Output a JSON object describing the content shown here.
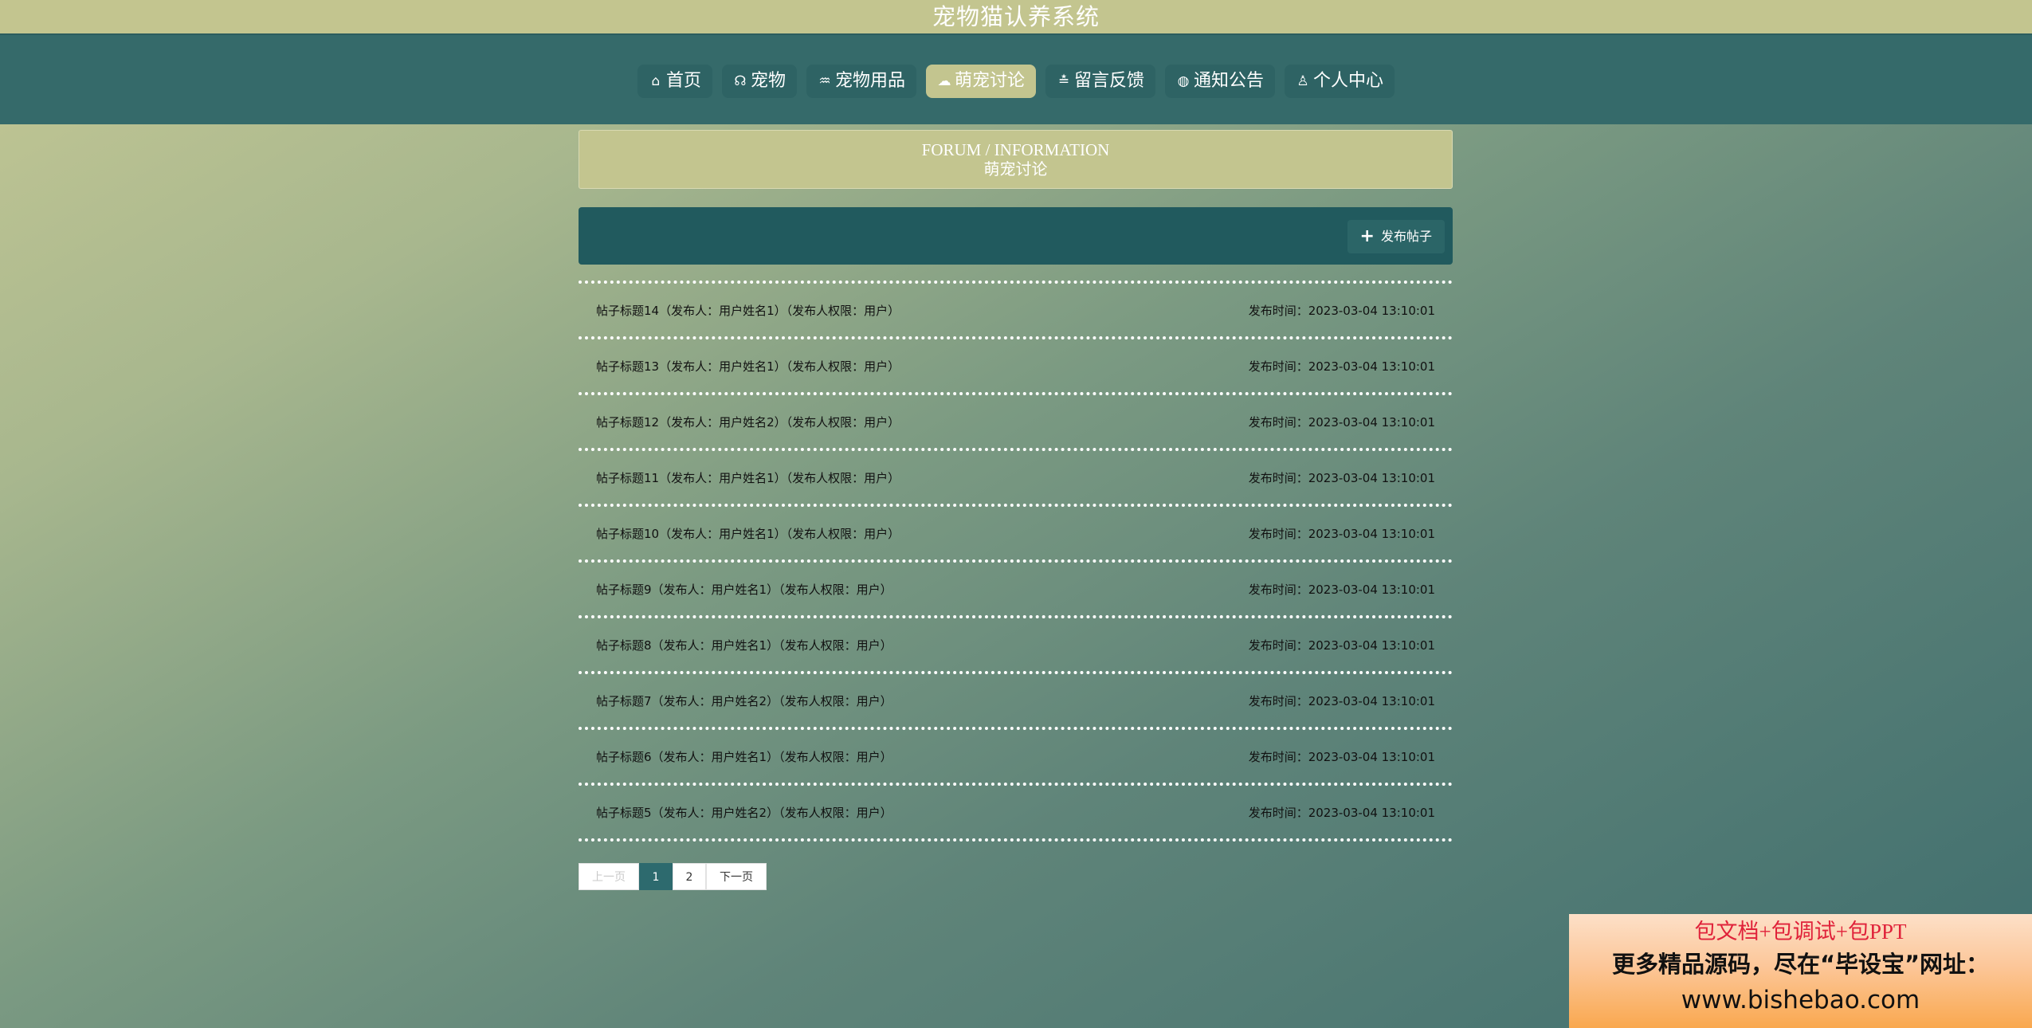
{
  "app": {
    "title": "宠物猫认养系统"
  },
  "nav": [
    {
      "icon": "home-icon",
      "glyph": "⌂",
      "label": "首页",
      "active": false
    },
    {
      "icon": "pet-icon",
      "glyph": "☊",
      "label": "宠物",
      "active": false
    },
    {
      "icon": "supplies-icon",
      "glyph": "♒",
      "label": "宠物用品",
      "active": false
    },
    {
      "icon": "cloud-icon",
      "glyph": "☁",
      "label": "萌宠讨论",
      "active": true
    },
    {
      "icon": "sliders-icon",
      "glyph": "≛",
      "label": "留言反馈",
      "active": false
    },
    {
      "icon": "globe-icon",
      "glyph": "◍",
      "label": "通知公告",
      "active": false
    },
    {
      "icon": "user-icon",
      "glyph": "♙",
      "label": "个人中心",
      "active": false
    }
  ],
  "banner": {
    "en": "FORUM / INFORMATION",
    "cn": "萌宠讨论"
  },
  "toolbar": {
    "add_label": "发布帖子"
  },
  "posts": [
    {
      "title": "帖子标题14（发布人：用户姓名1）（发布人权限：用户）",
      "time": "发布时间：2023-03-04 13:10:01"
    },
    {
      "title": "帖子标题13（发布人：用户姓名1）（发布人权限：用户）",
      "time": "发布时间：2023-03-04 13:10:01"
    },
    {
      "title": "帖子标题12（发布人：用户姓名2）（发布人权限：用户）",
      "time": "发布时间：2023-03-04 13:10:01"
    },
    {
      "title": "帖子标题11（发布人：用户姓名1）（发布人权限：用户）",
      "time": "发布时间：2023-03-04 13:10:01"
    },
    {
      "title": "帖子标题10（发布人：用户姓名1）（发布人权限：用户）",
      "time": "发布时间：2023-03-04 13:10:01"
    },
    {
      "title": "帖子标题9（发布人：用户姓名1）（发布人权限：用户）",
      "time": "发布时间：2023-03-04 13:10:01"
    },
    {
      "title": "帖子标题8（发布人：用户姓名1）（发布人权限：用户）",
      "time": "发布时间：2023-03-04 13:10:01"
    },
    {
      "title": "帖子标题7（发布人：用户姓名2）（发布人权限：用户）",
      "time": "发布时间：2023-03-04 13:10:01"
    },
    {
      "title": "帖子标题6（发布人：用户姓名1）（发布人权限：用户）",
      "time": "发布时间：2023-03-04 13:10:01"
    },
    {
      "title": "帖子标题5（发布人：用户姓名2）（发布人权限：用户）",
      "time": "发布时间：2023-03-04 13:10:01"
    }
  ],
  "pager": {
    "prev": "上一页",
    "pages": [
      "1",
      "2"
    ],
    "current": "1",
    "next": "下一页"
  },
  "ad": {
    "line1": "包文档+包调试+包PPT",
    "line2": "更多精品源码，尽在“毕设宝”网址：",
    "line3": "www.bishebao.com"
  },
  "colors": {
    "header": "#356a6a",
    "accent": "#c3c58f",
    "toolbar": "#215a5e",
    "current_page": "#2d6a6e"
  }
}
